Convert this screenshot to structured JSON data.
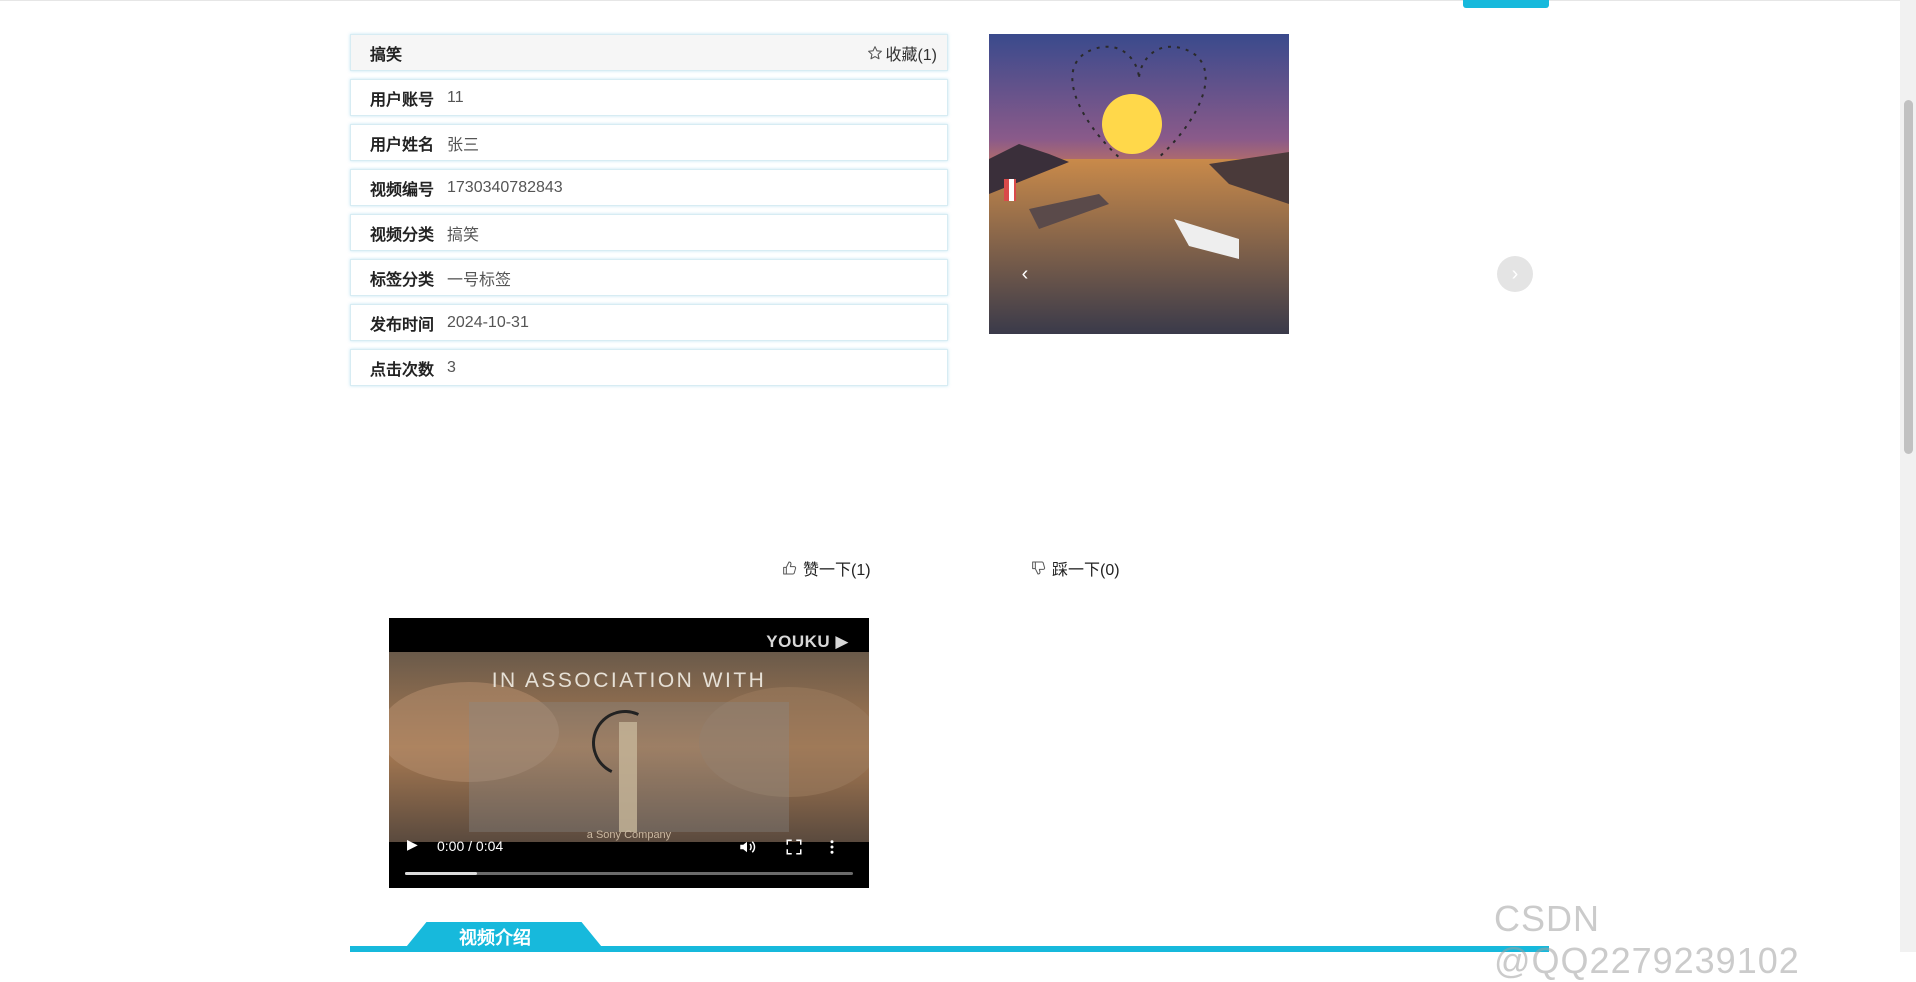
{
  "header": {
    "tab_color": "#17b9dc"
  },
  "detail": {
    "title": "搞笑",
    "favorite_label": "收藏(1)",
    "rows": [
      {
        "label": "用户账号",
        "value": "11"
      },
      {
        "label": "用户姓名",
        "value": "张三"
      },
      {
        "label": "视频编号",
        "value": "1730340782843"
      },
      {
        "label": "视频分类",
        "value": "搞笑"
      },
      {
        "label": "标签分类",
        "value": "一号标签"
      },
      {
        "label": "发布时间",
        "value": "2024-10-31"
      },
      {
        "label": "点击次数",
        "value": "3"
      }
    ]
  },
  "carousel": {
    "prev_glyph": "‹",
    "next_glyph": "›"
  },
  "votes": {
    "like_label": "赞一下(1)",
    "dislike_label": "踩一下(0)"
  },
  "video": {
    "brand": "YOUKU",
    "overlay_text": "IN ASSOCIATION WITH",
    "sub_text": "a Sony Company",
    "time": "0:00 / 0:04",
    "progress_fraction": 0.16
  },
  "intro": {
    "tab_label": "视频介绍"
  },
  "watermark": "CSDN @QQ2279239102",
  "colors": {
    "accent": "#17b9dc",
    "border": "#d7ecf3"
  }
}
